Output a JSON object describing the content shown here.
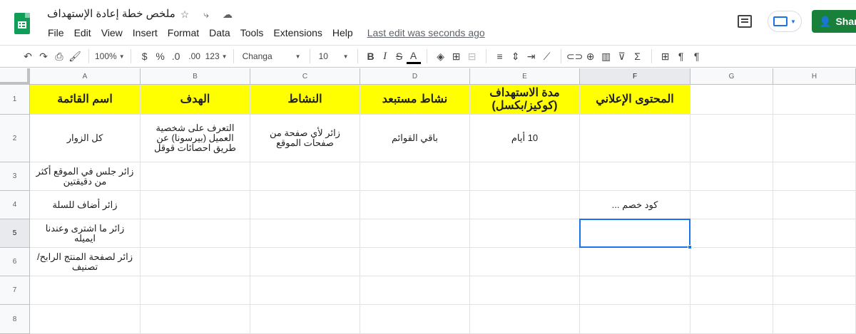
{
  "doc": {
    "title": "ملخص خطة إعادة الإستهداف",
    "star_icon": "☆",
    "move_icon": "⤷",
    "cloud_icon": "☁"
  },
  "menu": [
    "File",
    "Edit",
    "View",
    "Insert",
    "Format",
    "Data",
    "Tools",
    "Extensions",
    "Help"
  ],
  "last_edit": "Last edit seconds ago",
  "last_edit_full": "Last edit was seconds ago",
  "share_label": "Share",
  "toolbar": {
    "undo": "↶",
    "redo": "↷",
    "print": "⎙",
    "paint_format": "🖌",
    "zoom": "100%",
    "currency": "$",
    "percent": "%",
    "dec_decrease": ".0",
    "dec_increase": ".00",
    "more_formats": "123",
    "font": "Changa",
    "font_size": "10",
    "bold": "B",
    "italic": "I",
    "strike": "S",
    "text_color": "A",
    "fill": "◈",
    "borders": "⊞",
    "merge": "⊟",
    "halign": "≡",
    "valign": "⇕",
    "wrap": "⇥",
    "rotate": "⟋",
    "link": "⊂⊃",
    "comment": "⊕",
    "chart": "▥",
    "filter": "⊽",
    "functions": "Σ",
    "input_tools": "⊞",
    "ltr": "¶",
    "rtl": "¶"
  },
  "columns": [
    "A",
    "B",
    "C",
    "D",
    "E",
    "F",
    "G",
    "H"
  ],
  "rows": [
    "1",
    "2",
    "3",
    "4",
    "5",
    "6",
    "7",
    "8"
  ],
  "cells": {
    "r1": [
      "اسم القائمة",
      "الهدف",
      "النشاط",
      "نشاط مستبعد",
      "مدة الاستهداف (كوكيز/بكسل)",
      "المحتوى الإعلاني"
    ],
    "r2": [
      "كل الزوار",
      "التعرف على شخصية العميل (بيرسونا) عن طريق احصائات قوقل",
      "زائر لأي صفحة من صفحات الموقع",
      "باقي القوائم",
      "10 أيام",
      ""
    ],
    "r3": [
      "زائر جلس في الموقع أكثر من دقيقتين",
      "",
      "",
      "",
      "",
      ""
    ],
    "r4": [
      "زائر أضاف للسلة",
      "",
      "",
      "",
      "",
      "كود خصم ..."
    ],
    "r5": [
      "زائر ما اشترى وعندنا ايميله",
      "",
      "",
      "",
      "",
      ""
    ],
    "r6": [
      "زائر لصفحة المنتج الرابح/ تصنيف",
      "",
      "",
      "",
      "",
      ""
    ],
    "r7": [
      "",
      "",
      "",
      "",
      "",
      ""
    ],
    "r8": [
      "",
      "",
      "",
      "",
      "",
      ""
    ]
  },
  "colors": {
    "header_fill": "#ffff00",
    "selection": "#1a73e8",
    "share": "#188038"
  }
}
